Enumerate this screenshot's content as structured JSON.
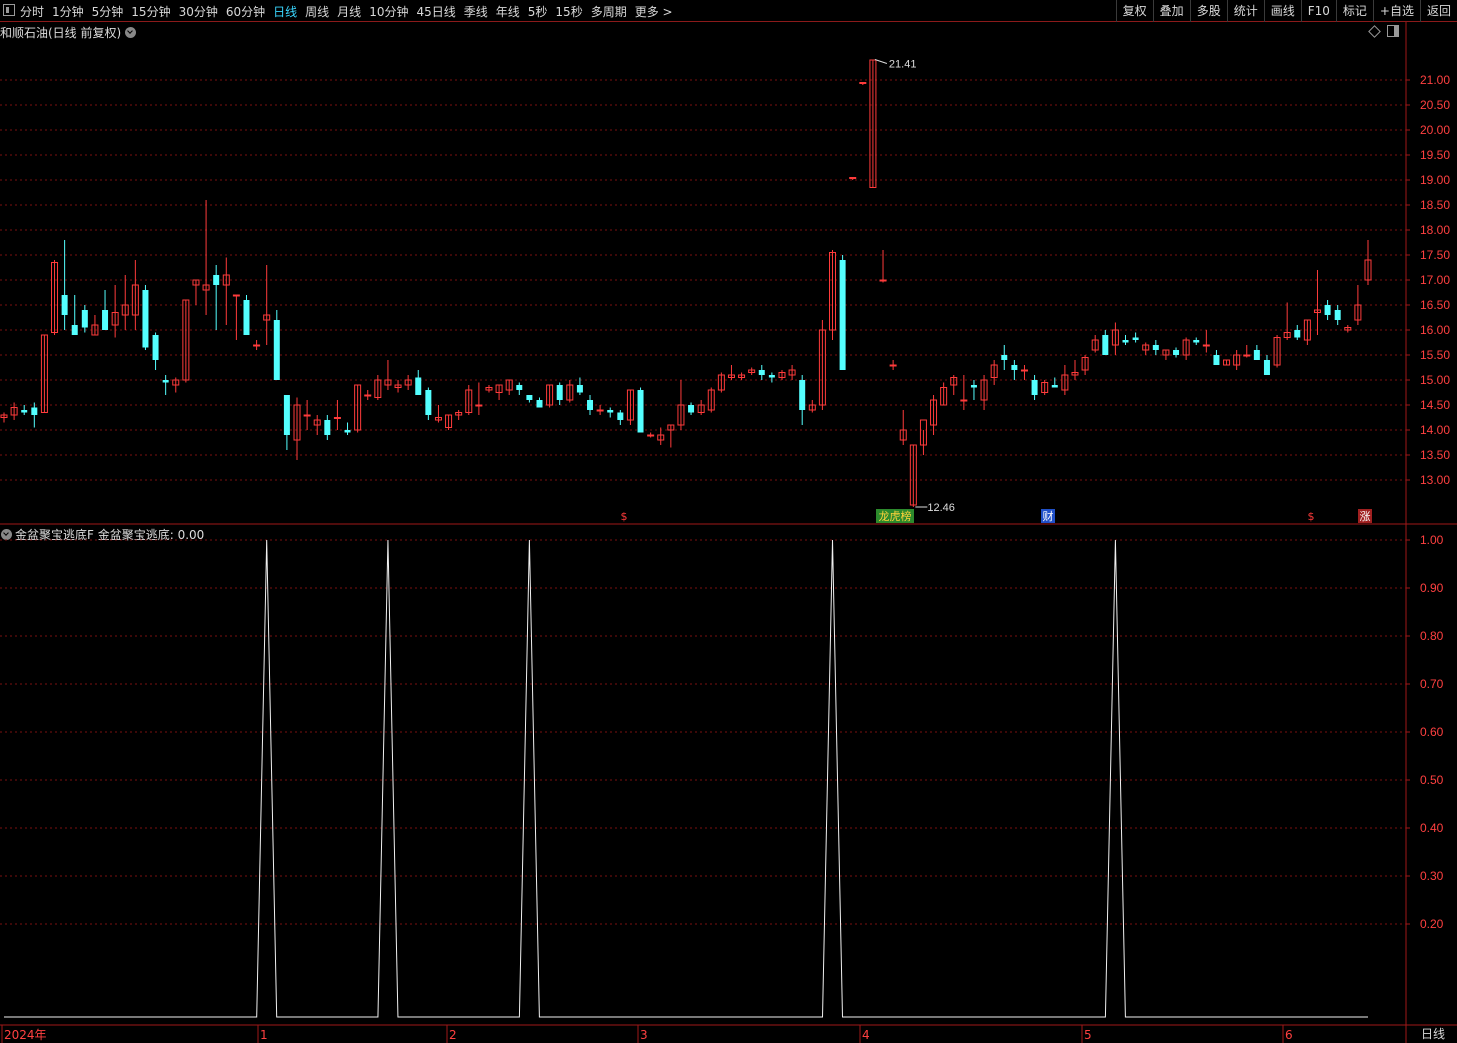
{
  "toolbar": {
    "periods": [
      "分时",
      "1分钟",
      "5分钟",
      "15分钟",
      "30分钟",
      "60分钟",
      "日线",
      "周线",
      "月线",
      "10分钟",
      "45日线",
      "季线",
      "年线",
      "5秒",
      "15秒",
      "多周期",
      "更多 >"
    ],
    "active_period": "日线",
    "tools": [
      "复权",
      "叠加",
      "多股",
      "统计",
      "画线",
      "F10",
      "标记",
      "+自选",
      "返回"
    ]
  },
  "main_chart": {
    "title": "和顺石油(日线 前复权)",
    "price_axis_labels": [
      "21.00",
      "20.50",
      "20.00",
      "19.50",
      "19.00",
      "18.50",
      "18.00",
      "17.50",
      "17.00",
      "16.50",
      "16.00",
      "15.50",
      "15.00",
      "14.50",
      "14.00",
      "13.50",
      "13.00"
    ],
    "high_label": "21.41",
    "low_label": "12.46",
    "markers": [
      {
        "text": "$",
        "color": "#ff3b3b",
        "bg": "#000"
      },
      {
        "text": "龙虎榜",
        "color": "#ffd23b",
        "bg": "#2c8a2c"
      },
      {
        "text": "财",
        "color": "#ffffff",
        "bg": "#2050c8"
      },
      {
        "text": "$",
        "color": "#ff3b3b",
        "bg": "#000"
      },
      {
        "text": "涨",
        "color": "#ffffff",
        "bg": "#a02020"
      }
    ]
  },
  "indicator": {
    "title": "金盆聚宝逃底F  金盆聚宝逃底: 0.00",
    "axis_labels": [
      "1.00",
      "0.90",
      "0.80",
      "0.70",
      "0.60",
      "0.50",
      "0.40",
      "0.30",
      "0.20"
    ]
  },
  "time_axis": [
    "2024年",
    "1",
    "2",
    "3",
    "4",
    "5",
    "6"
  ],
  "bottom_tab": "日线",
  "colors": {
    "up": "#ff3b3b",
    "down": "#54ffff",
    "grid": "#7a1010",
    "frame": "#a01818",
    "axis_text": "#ff4040"
  },
  "chart_data": {
    "type": "candlestick",
    "ohlc": [
      [
        14.25,
        14.35,
        14.15,
        14.3
      ],
      [
        14.3,
        14.55,
        14.2,
        14.45
      ],
      [
        14.4,
        14.5,
        14.3,
        14.35
      ],
      [
        14.45,
        14.55,
        14.05,
        14.3
      ],
      [
        14.35,
        15.9,
        14.35,
        15.9
      ],
      [
        15.95,
        17.4,
        15.9,
        17.35
      ],
      [
        16.7,
        17.8,
        16.0,
        16.3
      ],
      [
        16.1,
        16.7,
        15.9,
        15.9
      ],
      [
        16.4,
        16.5,
        15.95,
        16.05
      ],
      [
        15.9,
        16.3,
        15.9,
        16.1
      ],
      [
        16.4,
        16.8,
        16.0,
        16.0
      ],
      [
        16.1,
        16.9,
        15.85,
        16.35
      ],
      [
        16.3,
        17.1,
        16.0,
        16.5
      ],
      [
        16.3,
        17.4,
        16.0,
        16.9
      ],
      [
        16.8,
        16.9,
        15.6,
        15.65
      ],
      [
        15.9,
        15.95,
        15.2,
        15.4
      ],
      [
        15.0,
        15.1,
        14.7,
        14.95
      ],
      [
        14.9,
        15.05,
        14.75,
        15.0
      ],
      [
        15.0,
        16.6,
        14.95,
        16.6
      ],
      [
        16.9,
        17.0,
        16.5,
        17.0
      ],
      [
        16.8,
        18.6,
        16.3,
        16.9
      ],
      [
        17.1,
        17.3,
        16.0,
        16.9
      ],
      [
        16.9,
        17.45,
        16.1,
        17.1
      ],
      [
        16.7,
        16.7,
        15.8,
        16.7
      ],
      [
        16.6,
        16.7,
        15.9,
        15.9
      ],
      [
        15.7,
        15.8,
        15.6,
        15.7
      ],
      [
        16.2,
        17.3,
        15.7,
        16.3
      ],
      [
        16.2,
        16.4,
        15.0,
        15.0
      ],
      [
        14.7,
        14.7,
        13.6,
        13.9
      ],
      [
        13.8,
        14.65,
        13.4,
        14.5
      ],
      [
        14.3,
        14.6,
        14.0,
        14.3
      ],
      [
        14.1,
        14.3,
        13.9,
        14.2
      ],
      [
        14.2,
        14.3,
        13.8,
        13.9
      ],
      [
        14.25,
        14.6,
        14.0,
        14.25
      ],
      [
        14.0,
        14.15,
        13.9,
        13.95
      ],
      [
        14.0,
        14.9,
        13.95,
        14.9
      ],
      [
        14.7,
        14.8,
        14.6,
        14.7
      ],
      [
        14.65,
        15.1,
        14.6,
        15.0
      ],
      [
        14.9,
        15.4,
        14.8,
        15.0
      ],
      [
        14.85,
        15.0,
        14.75,
        14.9
      ],
      [
        14.9,
        15.1,
        14.8,
        15.0
      ],
      [
        15.05,
        15.2,
        14.7,
        14.7
      ],
      [
        14.8,
        14.85,
        14.2,
        14.3
      ],
      [
        14.2,
        14.5,
        14.15,
        14.25
      ],
      [
        14.05,
        14.3,
        14.0,
        14.3
      ],
      [
        14.3,
        14.4,
        14.2,
        14.35
      ],
      [
        14.35,
        14.9,
        14.3,
        14.8
      ],
      [
        14.5,
        14.95,
        14.3,
        14.5
      ],
      [
        14.8,
        14.9,
        14.75,
        14.85
      ],
      [
        14.75,
        14.9,
        14.6,
        14.9
      ],
      [
        14.8,
        15.0,
        14.7,
        15.0
      ],
      [
        14.9,
        14.95,
        14.7,
        14.8
      ],
      [
        14.7,
        14.7,
        14.55,
        14.6
      ],
      [
        14.6,
        14.65,
        14.45,
        14.45
      ],
      [
        14.5,
        14.9,
        14.45,
        14.9
      ],
      [
        14.9,
        14.95,
        14.5,
        14.6
      ],
      [
        14.6,
        15.0,
        14.55,
        14.9
      ],
      [
        14.9,
        15.05,
        14.7,
        14.75
      ],
      [
        14.6,
        14.7,
        14.3,
        14.4
      ],
      [
        14.4,
        14.5,
        14.3,
        14.4
      ],
      [
        14.4,
        14.45,
        14.25,
        14.35
      ],
      [
        14.35,
        14.4,
        14.1,
        14.2
      ],
      [
        14.2,
        14.8,
        14.1,
        14.8
      ],
      [
        14.8,
        14.85,
        13.95,
        13.95
      ],
      [
        13.9,
        13.95,
        13.85,
        13.9
      ],
      [
        13.8,
        14.05,
        13.7,
        13.9
      ],
      [
        14.0,
        14.1,
        13.65,
        14.1
      ],
      [
        14.1,
        15.0,
        14.0,
        14.5
      ],
      [
        14.5,
        14.55,
        14.3,
        14.35
      ],
      [
        14.35,
        14.6,
        14.3,
        14.5
      ],
      [
        14.4,
        14.85,
        14.35,
        14.8
      ],
      [
        14.8,
        15.15,
        14.75,
        15.1
      ],
      [
        15.05,
        15.3,
        15.0,
        15.1
      ],
      [
        15.05,
        15.15,
        15.0,
        15.1
      ],
      [
        15.15,
        15.25,
        15.1,
        15.2
      ],
      [
        15.2,
        15.3,
        15.0,
        15.1
      ],
      [
        15.1,
        15.15,
        14.95,
        15.05
      ],
      [
        15.05,
        15.2,
        15.0,
        15.15
      ],
      [
        15.1,
        15.3,
        15.0,
        15.2
      ],
      [
        15.0,
        15.1,
        14.1,
        14.4
      ],
      [
        14.4,
        14.6,
        14.35,
        14.5
      ],
      [
        14.5,
        16.2,
        14.4,
        16.0
      ],
      [
        16.0,
        17.6,
        15.8,
        17.55
      ],
      [
        17.4,
        17.5,
        15.2,
        15.2
      ],
      [
        19.05,
        19.05,
        19.0,
        19.05
      ],
      [
        20.95,
        20.95,
        20.9,
        20.95
      ],
      [
        18.85,
        21.41,
        18.85,
        21.4
      ],
      [
        17.0,
        17.6,
        16.95,
        17.0
      ],
      [
        15.3,
        15.4,
        15.2,
        15.3
      ],
      [
        13.8,
        14.4,
        13.7,
        14.0
      ],
      [
        12.5,
        13.7,
        12.46,
        13.7
      ],
      [
        13.7,
        14.0,
        13.5,
        14.2
      ],
      [
        14.1,
        14.7,
        13.9,
        14.6
      ],
      [
        14.5,
        14.95,
        14.5,
        14.85
      ],
      [
        14.9,
        15.1,
        14.7,
        15.05
      ],
      [
        14.6,
        15.1,
        14.4,
        14.6
      ],
      [
        14.9,
        15.0,
        14.6,
        14.85
      ],
      [
        14.6,
        15.1,
        14.4,
        15.0
      ],
      [
        15.05,
        15.4,
        14.9,
        15.3
      ],
      [
        15.5,
        15.7,
        15.2,
        15.4
      ],
      [
        15.3,
        15.4,
        15.0,
        15.2
      ],
      [
        15.2,
        15.3,
        15.0,
        15.2
      ],
      [
        15.0,
        15.1,
        14.6,
        14.7
      ],
      [
        14.75,
        15.0,
        14.7,
        14.95
      ],
      [
        14.9,
        15.05,
        14.85,
        14.85
      ],
      [
        14.8,
        15.3,
        14.7,
        15.1
      ],
      [
        15.1,
        15.4,
        15.0,
        15.15
      ],
      [
        15.2,
        15.5,
        15.1,
        15.45
      ],
      [
        15.6,
        15.9,
        15.55,
        15.8
      ],
      [
        15.9,
        16.0,
        15.5,
        15.5
      ],
      [
        15.7,
        16.15,
        15.5,
        16.0
      ],
      [
        15.8,
        15.9,
        15.7,
        15.75
      ],
      [
        15.85,
        15.95,
        15.75,
        15.8
      ],
      [
        15.6,
        15.75,
        15.5,
        15.7
      ],
      [
        15.7,
        15.8,
        15.5,
        15.6
      ],
      [
        15.5,
        15.6,
        15.4,
        15.6
      ],
      [
        15.6,
        15.65,
        15.45,
        15.5
      ],
      [
        15.5,
        15.85,
        15.4,
        15.8
      ],
      [
        15.8,
        15.85,
        15.7,
        15.75
      ],
      [
        15.7,
        16.0,
        15.55,
        15.7
      ],
      [
        15.5,
        15.6,
        15.3,
        15.3
      ],
      [
        15.3,
        15.4,
        15.3,
        15.4
      ],
      [
        15.3,
        15.6,
        15.2,
        15.5
      ],
      [
        15.5,
        15.7,
        15.45,
        15.5
      ],
      [
        15.6,
        15.7,
        15.4,
        15.4
      ],
      [
        15.4,
        15.5,
        15.1,
        15.1
      ],
      [
        15.3,
        15.9,
        15.25,
        15.85
      ],
      [
        15.85,
        16.55,
        15.8,
        15.95
      ],
      [
        16.0,
        16.1,
        15.8,
        15.85
      ],
      [
        15.8,
        16.2,
        15.7,
        16.2
      ],
      [
        16.35,
        17.2,
        15.9,
        16.4
      ],
      [
        16.5,
        16.6,
        16.2,
        16.3
      ],
      [
        16.4,
        16.5,
        16.1,
        16.2
      ],
      [
        16.0,
        16.1,
        15.95,
        16.05
      ],
      [
        16.2,
        16.9,
        16.1,
        16.5
      ],
      [
        17.0,
        17.8,
        16.9,
        17.4
      ]
    ],
    "ylim": [
      12.2,
      21.8
    ],
    "indicator": {
      "type": "spike",
      "values_range": [
        0,
        1
      ],
      "spike_positions": [
        26,
        38,
        52,
        82,
        110
      ]
    }
  }
}
